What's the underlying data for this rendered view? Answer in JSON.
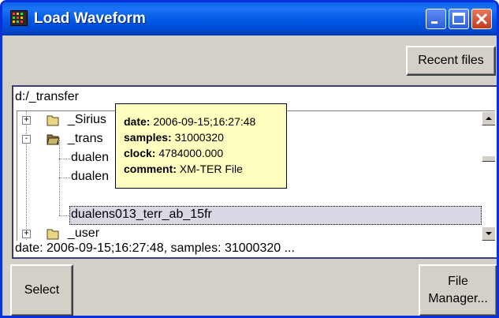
{
  "window": {
    "title": "Load Waveform",
    "accent": "#0058e5"
  },
  "toolbar": {
    "recent_label": "Recent files"
  },
  "browser": {
    "path": "d:/_transfer",
    "tree": [
      {
        "label": "_Sirius",
        "expander": "+",
        "kind": "folder"
      },
      {
        "label": "_trans",
        "expander": "-",
        "kind": "folder-open"
      },
      {
        "label": "dualen",
        "kind": "file"
      },
      {
        "label": "dualen",
        "kind": "file"
      },
      {
        "label": "dualens013_terr_ab_15fr",
        "kind": "file",
        "selected": true
      },
      {
        "label": "_user",
        "expander": "+",
        "kind": "folder"
      }
    ],
    "status": "date: 2006-09-15;16:27:48, samples: 31000320 ..."
  },
  "tooltip": {
    "date_key": "date:",
    "date_val": "2006-09-15;16:27:48",
    "samples_key": "samples:",
    "samples_val": "31000320",
    "clock_key": "clock:",
    "clock_val": "4784000.000",
    "comment_key": "comment:",
    "comment_val": "XM-TER File"
  },
  "actions": {
    "select_label": "Select",
    "file_manager_line1": "File",
    "file_manager_line2": "Manager..."
  },
  "icons": {
    "app": "waveform-app-icon",
    "minimize": "minimize-icon",
    "maximize": "maximize-icon",
    "close": "close-icon",
    "folder": "folder-icon",
    "scroll_up": "arrow-up-icon",
    "scroll_down": "arrow-down-icon"
  }
}
